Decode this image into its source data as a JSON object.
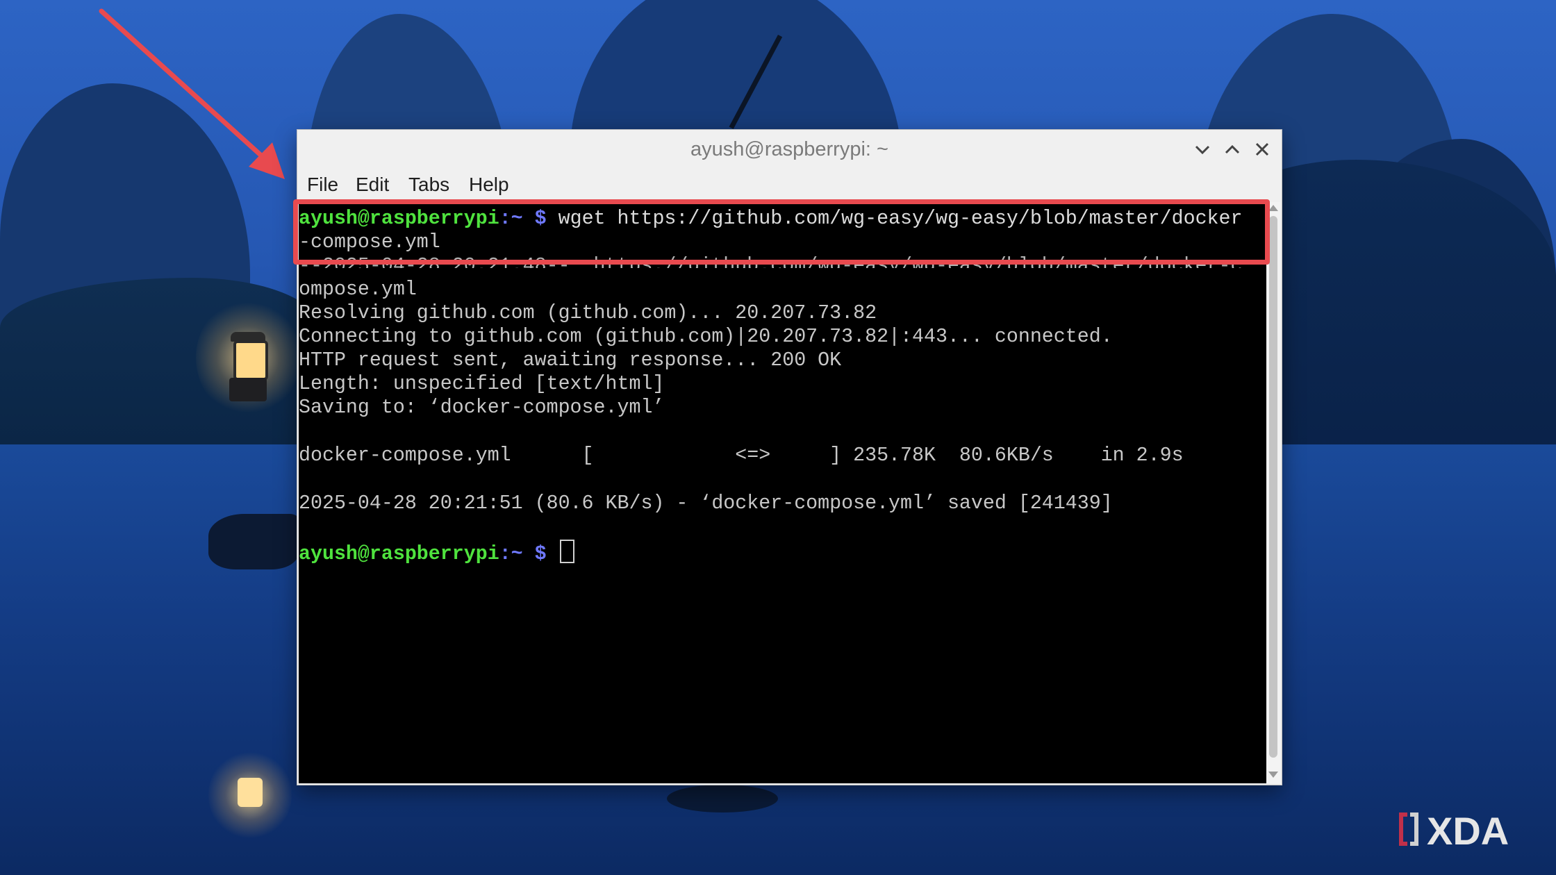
{
  "window": {
    "title": "ayush@raspberrypi: ~"
  },
  "menu": {
    "file": "File",
    "edit": "Edit",
    "tabs": "Tabs",
    "help": "Help"
  },
  "terminal": {
    "prompt_user": "ayush@raspberrypi",
    "prompt_path": ":~ $",
    "command_line1": " wget https://github.com/wg-easy/wg-easy/blob/master/docker",
    "command_line2": "-compose.yml",
    "line_partial": "--2025-04-28 20:21:48--  https://github.com/wg-easy/wg-easy/blob/master/docker-c",
    "line_ompose": "ompose.yml",
    "line_resolving": "Resolving github.com (github.com)... 20.207.73.82",
    "line_connecting": "Connecting to github.com (github.com)|20.207.73.82|:443... connected.",
    "line_http": "HTTP request sent, awaiting response... 200 OK",
    "line_length": "Length: unspecified [text/html]",
    "line_saving": "Saving to: ‘docker-compose.yml’",
    "line_progress": "docker-compose.yml      [            <=>     ] 235.78K  80.6KB/s    in 2.9s",
    "line_saved": "2025-04-28 20:21:51 (80.6 KB/s) - ‘docker-compose.yml’ saved [241439]"
  },
  "watermark": {
    "brand": "XDA"
  },
  "colors": {
    "prompt_user": "#4fe33e",
    "prompt_path": "#6f79ff",
    "highlight_border": "#e84a4f",
    "arrow": "#e84a4f"
  }
}
